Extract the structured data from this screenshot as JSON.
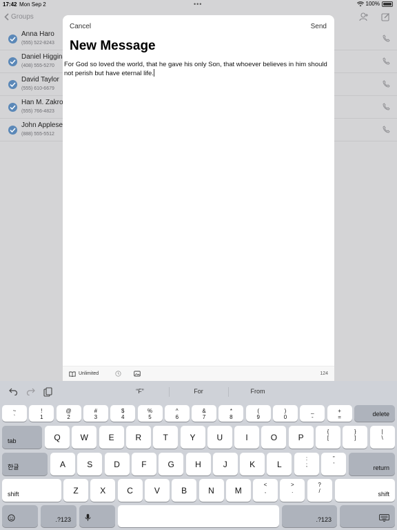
{
  "status": {
    "time": "17:42",
    "date": "Mon Sep 2",
    "battery": "100%"
  },
  "background": {
    "back_label": "Groups",
    "contacts": [
      {
        "name": "Anna Haro",
        "phone": "(555) 522-8243"
      },
      {
        "name": "Daniel Higgins",
        "phone": "(408) 555-5270"
      },
      {
        "name": "David Taylor",
        "phone": "(555) 610-6679"
      },
      {
        "name": "Han M. Zakrot",
        "phone": "(555) 766-4823"
      },
      {
        "name": "John Applese",
        "phone": "(888) 555-5512"
      }
    ]
  },
  "modal": {
    "cancel": "Cancel",
    "send": "Send",
    "title": "New Message",
    "body": "For God so loved the world, that he gave his only Son, that whoever believes in him should not perish but have eternal life.",
    "plan": "Unlimited",
    "char_count": "124"
  },
  "keyboard": {
    "suggestions": [
      "“F”",
      "For",
      "From"
    ],
    "row1": [
      {
        "top": "~",
        "bot": "`"
      },
      {
        "top": "!",
        "bot": "1"
      },
      {
        "top": "@",
        "bot": "2"
      },
      {
        "top": "#",
        "bot": "3"
      },
      {
        "top": "$",
        "bot": "4"
      },
      {
        "top": "%",
        "bot": "5"
      },
      {
        "top": "^",
        "bot": "6"
      },
      {
        "top": "&",
        "bot": "7"
      },
      {
        "top": "*",
        "bot": "8"
      },
      {
        "top": "(",
        "bot": "9"
      },
      {
        "top": ")",
        "bot": "0"
      },
      {
        "top": "_",
        "bot": "-"
      },
      {
        "top": "+",
        "bot": "="
      }
    ],
    "delete": "delete",
    "tab": "tab",
    "row2": [
      "Q",
      "W",
      "E",
      "R",
      "T",
      "Y",
      "U",
      "I",
      "O",
      "P"
    ],
    "row2_sym": [
      {
        "top": "{",
        "bot": "["
      },
      {
        "top": "}",
        "bot": "]"
      },
      {
        "top": "|",
        "bot": "\\"
      }
    ],
    "lang": "한글",
    "row3": [
      "A",
      "S",
      "D",
      "F",
      "G",
      "H",
      "J",
      "K",
      "L"
    ],
    "row3_sym": [
      {
        "top": ":",
        "bot": ";"
      },
      {
        "top": "”",
        "bot": "’"
      }
    ],
    "return": "return",
    "shift": "shift",
    "row4": [
      "Z",
      "X",
      "C",
      "V",
      "B",
      "N",
      "M"
    ],
    "row4_sym": [
      {
        "top": "<",
        "bot": ","
      },
      {
        "top": ">",
        "bot": "."
      },
      {
        "top": "?",
        "bot": "/"
      }
    ],
    "numbers": ".?123"
  }
}
